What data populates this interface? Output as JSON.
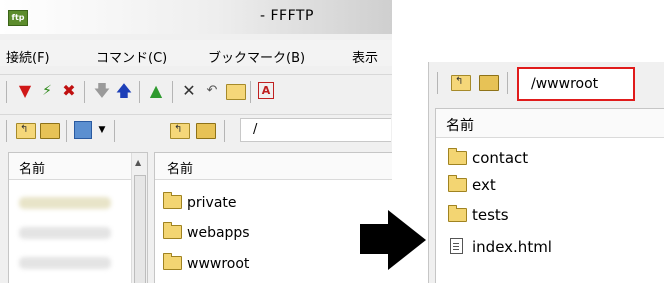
{
  "left_window": {
    "title": "- FFFTP",
    "app_icon_text": "ftp",
    "menu": [
      "接続(F)",
      "コマンド(C)",
      "ブックマーク(B)",
      "表示"
    ],
    "toolbar1_icons": [
      "connect-icon",
      "quick-connect-icon",
      "disconnect-icon",
      "download-icon",
      "upload-icon",
      "mirror-upload-icon",
      "delete-icon",
      "rename-icon",
      "mkdir-icon",
      "ascii-mode-icon"
    ],
    "toolbar2_icons": [
      "parent-folder-icon",
      "open-folder-icon",
      "host-folder-icon",
      "dropdown-icon",
      "parent-folder-icon",
      "open-folder-icon"
    ],
    "local_pane": {
      "header": "名前"
    },
    "remote_path": "/",
    "remote_pane": {
      "header": "名前",
      "items": [
        "private",
        "webapps",
        "wwwroot"
      ]
    }
  },
  "right_window": {
    "path": "/wwwroot",
    "path_highlight_color": "#e01b1b",
    "header": "名前",
    "items": [
      {
        "name": "contact",
        "type": "folder"
      },
      {
        "name": "ext",
        "type": "folder"
      },
      {
        "name": "tests",
        "type": "folder"
      },
      {
        "name": "index.html",
        "type": "file"
      }
    ]
  },
  "arrow": {
    "direction": "right",
    "color": "#000000"
  }
}
